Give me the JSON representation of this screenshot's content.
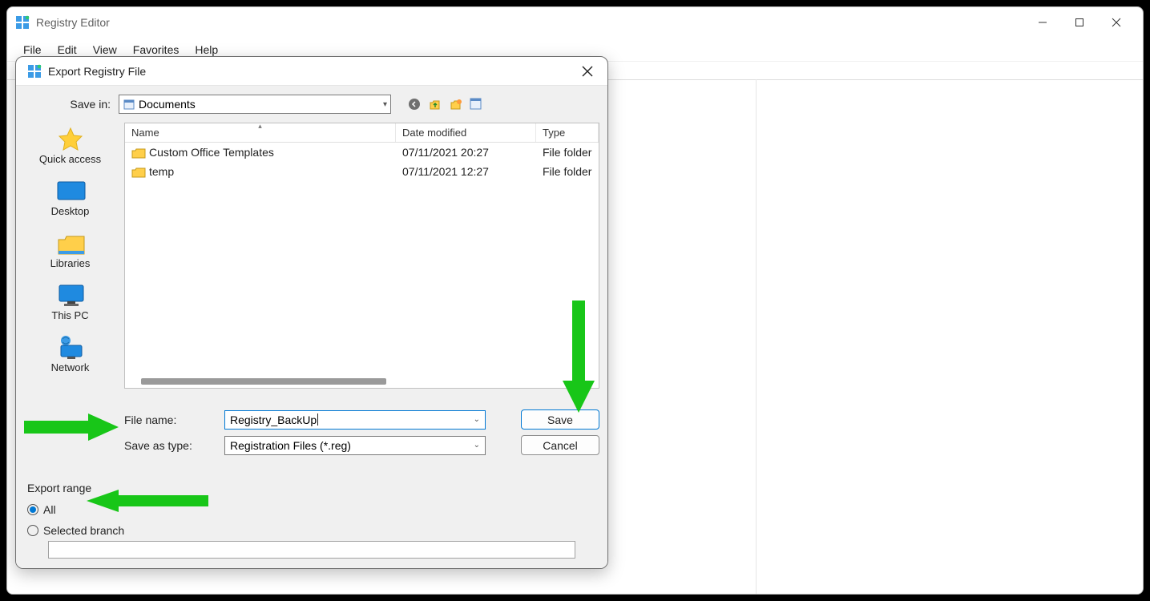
{
  "window": {
    "title": "Registry Editor",
    "menus": [
      "File",
      "Edit",
      "View",
      "Favorites",
      "Help"
    ]
  },
  "dialog": {
    "title": "Export Registry File",
    "save_in_label": "Save in:",
    "save_in_value": "Documents",
    "places": [
      {
        "label": "Quick access"
      },
      {
        "label": "Desktop"
      },
      {
        "label": "Libraries"
      },
      {
        "label": "This PC"
      },
      {
        "label": "Network"
      }
    ],
    "columns": {
      "name": "Name",
      "date": "Date modified",
      "type": "Type"
    },
    "rows": [
      {
        "name": "Custom Office Templates",
        "date": "07/11/2021 20:27",
        "type": "File folder"
      },
      {
        "name": "temp",
        "date": "07/11/2021 12:27",
        "type": "File folder"
      }
    ],
    "file_name_label": "File name:",
    "file_name_value": "Registry_BackUp",
    "save_type_label": "Save as type:",
    "save_type_value": "Registration Files (*.reg)",
    "save_btn": "Save",
    "cancel_btn": "Cancel",
    "export_range_label": "Export range",
    "radio_all": "All",
    "radio_selected": "Selected branch"
  }
}
